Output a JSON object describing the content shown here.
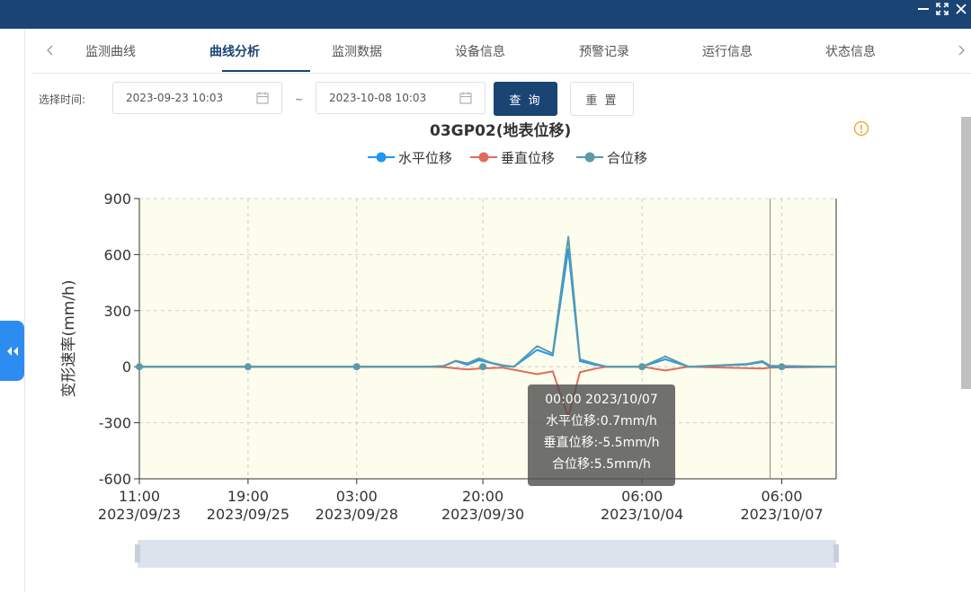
{
  "window": {
    "controls": [
      "minimize-icon",
      "fullscreen-icon",
      "close-icon"
    ]
  },
  "tabs": {
    "items": [
      {
        "label": "监测曲线",
        "active": false
      },
      {
        "label": "曲线分析",
        "active": true
      },
      {
        "label": "监测数据",
        "active": false
      },
      {
        "label": "设备信息",
        "active": false
      },
      {
        "label": "预警记录",
        "active": false
      },
      {
        "label": "运行信息",
        "active": false
      },
      {
        "label": "状态信息",
        "active": false
      }
    ]
  },
  "filter": {
    "label": "选择时间:",
    "start": "2023-09-23 10:03",
    "end": "2023-10-08 10:03",
    "separator": "~",
    "query_label": "查 询",
    "reset_label": "重 置"
  },
  "tooltip": {
    "time": "00:00 2023/10/07",
    "lines": [
      "水平位移:0.7mm/h",
      "垂直位移:-5.5mm/h",
      "合位移:5.5mm/h"
    ]
  },
  "colors": {
    "topbar": "#1a4474",
    "accent": "#2d8cf0",
    "series_horizontal": "#2196f3",
    "series_vertical": "#e06b5c",
    "series_resultant": "#5b9aa8",
    "plot_bg": "#fcfdec",
    "info_icon": "#f0a020"
  },
  "chart_data": {
    "type": "line",
    "title": "03GP02(地表位移)",
    "ylabel": "变形速率(mm/h)",
    "xlabel": "",
    "ylim": [
      -600,
      900
    ],
    "yticks": [
      900,
      600,
      300,
      0,
      -300,
      -600
    ],
    "xrange": [
      "2023-09-23 11:00",
      "2023-10-08 10:00"
    ],
    "xticks": [
      {
        "time": "11:00",
        "date": "2023/09/23",
        "iso": "2023-09-23 11:00"
      },
      {
        "time": "19:00",
        "date": "2023/09/25",
        "iso": "2023-09-25 19:00"
      },
      {
        "time": "03:00",
        "date": "2023/09/28",
        "iso": "2023-09-28 03:00"
      },
      {
        "time": "20:00",
        "date": "2023/09/30",
        "iso": "2023-09-30 20:00"
      },
      {
        "time": "06:00",
        "date": "2023/10/04",
        "iso": "2023-10-04 06:00"
      },
      {
        "time": "06:00",
        "date": "2023/10/07",
        "iso": "2023-10-07 06:00"
      }
    ],
    "grid": true,
    "legend_position": "top-center",
    "crosshair_x": "2023-10-07 00:00",
    "series": [
      {
        "name": "水平位移",
        "color": "#2196f3",
        "points": [
          [
            "2023-09-23 11:00",
            0
          ],
          [
            "2023-09-29 16:00",
            0
          ],
          [
            "2023-09-30 00:00",
            4
          ],
          [
            "2023-09-30 06:00",
            30
          ],
          [
            "2023-09-30 12:00",
            10
          ],
          [
            "2023-09-30 18:00",
            35
          ],
          [
            "2023-10-01 00:00",
            20
          ],
          [
            "2023-10-01 06:00",
            5
          ],
          [
            "2023-10-01 12:00",
            0
          ],
          [
            "2023-10-02 00:00",
            90
          ],
          [
            "2023-10-02 08:00",
            60
          ],
          [
            "2023-10-02 16:00",
            630
          ],
          [
            "2023-10-02 22:00",
            30
          ],
          [
            "2023-10-03 06:00",
            10
          ],
          [
            "2023-10-03 12:00",
            0
          ],
          [
            "2023-10-04 06:00",
            0
          ],
          [
            "2023-10-04 18:00",
            40
          ],
          [
            "2023-10-05 06:00",
            0
          ],
          [
            "2023-10-06 12:00",
            12
          ],
          [
            "2023-10-06 20:00",
            25
          ],
          [
            "2023-10-07 00:00",
            0.7
          ],
          [
            "2023-10-08 10:00",
            0
          ]
        ]
      },
      {
        "name": "垂直位移",
        "color": "#e06b5c",
        "points": [
          [
            "2023-09-23 11:00",
            0
          ],
          [
            "2023-09-29 16:00",
            0
          ],
          [
            "2023-09-30 00:00",
            -3
          ],
          [
            "2023-09-30 12:00",
            -15
          ],
          [
            "2023-09-30 18:00",
            -10
          ],
          [
            "2023-10-01 06:00",
            -5
          ],
          [
            "2023-10-02 00:00",
            -40
          ],
          [
            "2023-10-02 08:00",
            -25
          ],
          [
            "2023-10-02 16:00",
            -270
          ],
          [
            "2023-10-02 22:00",
            -30
          ],
          [
            "2023-10-03 06:00",
            -10
          ],
          [
            "2023-10-03 12:00",
            0
          ],
          [
            "2023-10-04 06:00",
            0
          ],
          [
            "2023-10-04 18:00",
            -20
          ],
          [
            "2023-10-05 06:00",
            0
          ],
          [
            "2023-10-06 20:00",
            -10
          ],
          [
            "2023-10-07 00:00",
            -5.5
          ],
          [
            "2023-10-08 10:00",
            0
          ]
        ]
      },
      {
        "name": "合位移",
        "color": "#5b9aa8",
        "points": [
          [
            "2023-09-23 11:00",
            0
          ],
          [
            "2023-09-29 16:00",
            0
          ],
          [
            "2023-09-30 00:00",
            5
          ],
          [
            "2023-09-30 06:00",
            32
          ],
          [
            "2023-09-30 12:00",
            18
          ],
          [
            "2023-09-30 18:00",
            45
          ],
          [
            "2023-10-01 00:00",
            22
          ],
          [
            "2023-10-01 06:00",
            8
          ],
          [
            "2023-10-01 12:00",
            0
          ],
          [
            "2023-10-02 00:00",
            110
          ],
          [
            "2023-10-02 08:00",
            70
          ],
          [
            "2023-10-02 16:00",
            695
          ],
          [
            "2023-10-02 22:00",
            40
          ],
          [
            "2023-10-03 06:00",
            15
          ],
          [
            "2023-10-03 12:00",
            0
          ],
          [
            "2023-10-04 06:00",
            0
          ],
          [
            "2023-10-04 18:00",
            55
          ],
          [
            "2023-10-05 06:00",
            0
          ],
          [
            "2023-10-06 12:00",
            15
          ],
          [
            "2023-10-06 20:00",
            30
          ],
          [
            "2023-10-07 00:00",
            5.5
          ],
          [
            "2023-10-08 10:00",
            0
          ]
        ]
      }
    ]
  }
}
